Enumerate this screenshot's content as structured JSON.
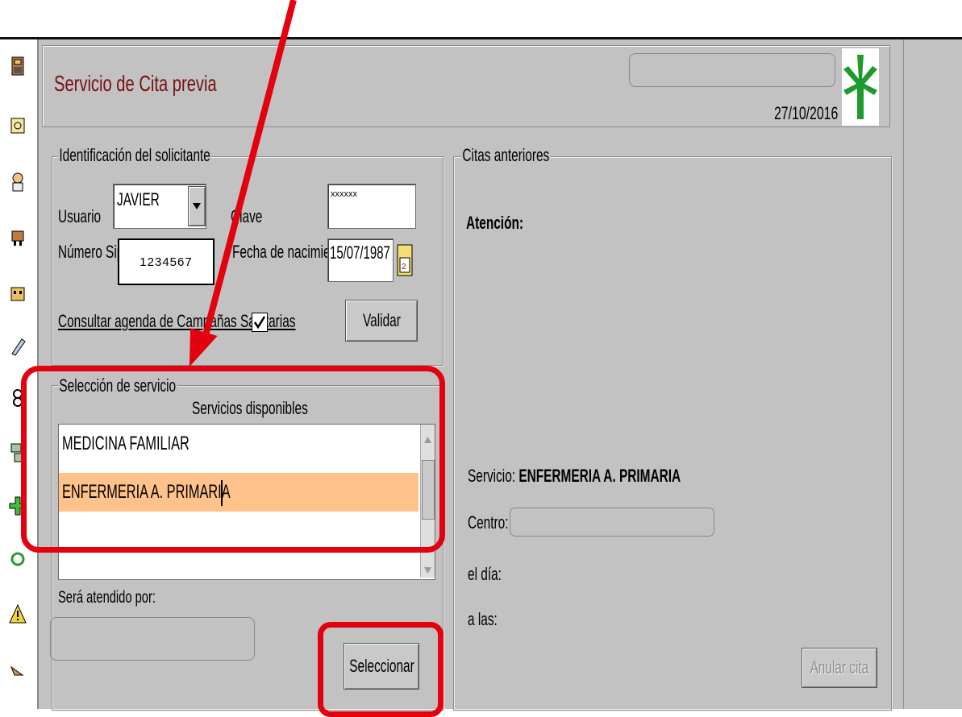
{
  "sidebar": {
    "icons": [
      "person-icon",
      "document-icon",
      "doctor-icon",
      "cart-icon",
      "building-icon",
      "pen-icon",
      "link-icon",
      "pages-icon",
      "plus-icon",
      "refresh-icon",
      "warning-icon",
      "pointer-icon"
    ]
  },
  "header": {
    "title": "Servicio de Cita previa",
    "date": "27/10/2016",
    "logo": "green-cross-logo"
  },
  "identificacion": {
    "group_label": "Identificación del solicitante",
    "usuario_label": "Usuario",
    "usuario_value": "JAVIER",
    "clave_label": "Clave",
    "clave_value": "xxxxxx",
    "sip_label": "Número Sip",
    "sip_value": "1234567",
    "fecha_label": "Fecha de nacimiento",
    "fecha_value": "15/07/1987",
    "consultar_label": "Consultar agenda de Campañas Sanitarias",
    "consultar_checked": true,
    "validar_label": "Validar"
  },
  "seleccion": {
    "group_label": "Selección de servicio",
    "list_header": "Servicios disponibles",
    "items": [
      "MEDICINA FAMILIAR",
      "ENFERMERIA A. PRIMARIA",
      ""
    ],
    "selected_index": 1,
    "selected_color": "#ffc28a",
    "atendido_label": "Será atendido por:",
    "atendido_value": "",
    "seleccionar_label": "Seleccionar"
  },
  "citas": {
    "group_label": "Citas anteriores",
    "atencion_label": "Atención:",
    "servicio_label": "Servicio:",
    "servicio_value": "ENFERMERIA A. PRIMARIA",
    "centro_label": "Centro:",
    "centro_value": "",
    "dia_label": "el día:",
    "horas_label": "a las:",
    "anular_label": "Anular cita"
  },
  "annotation": {
    "arrow_color": "#e3000f",
    "highlight_color": "#e3000f"
  }
}
